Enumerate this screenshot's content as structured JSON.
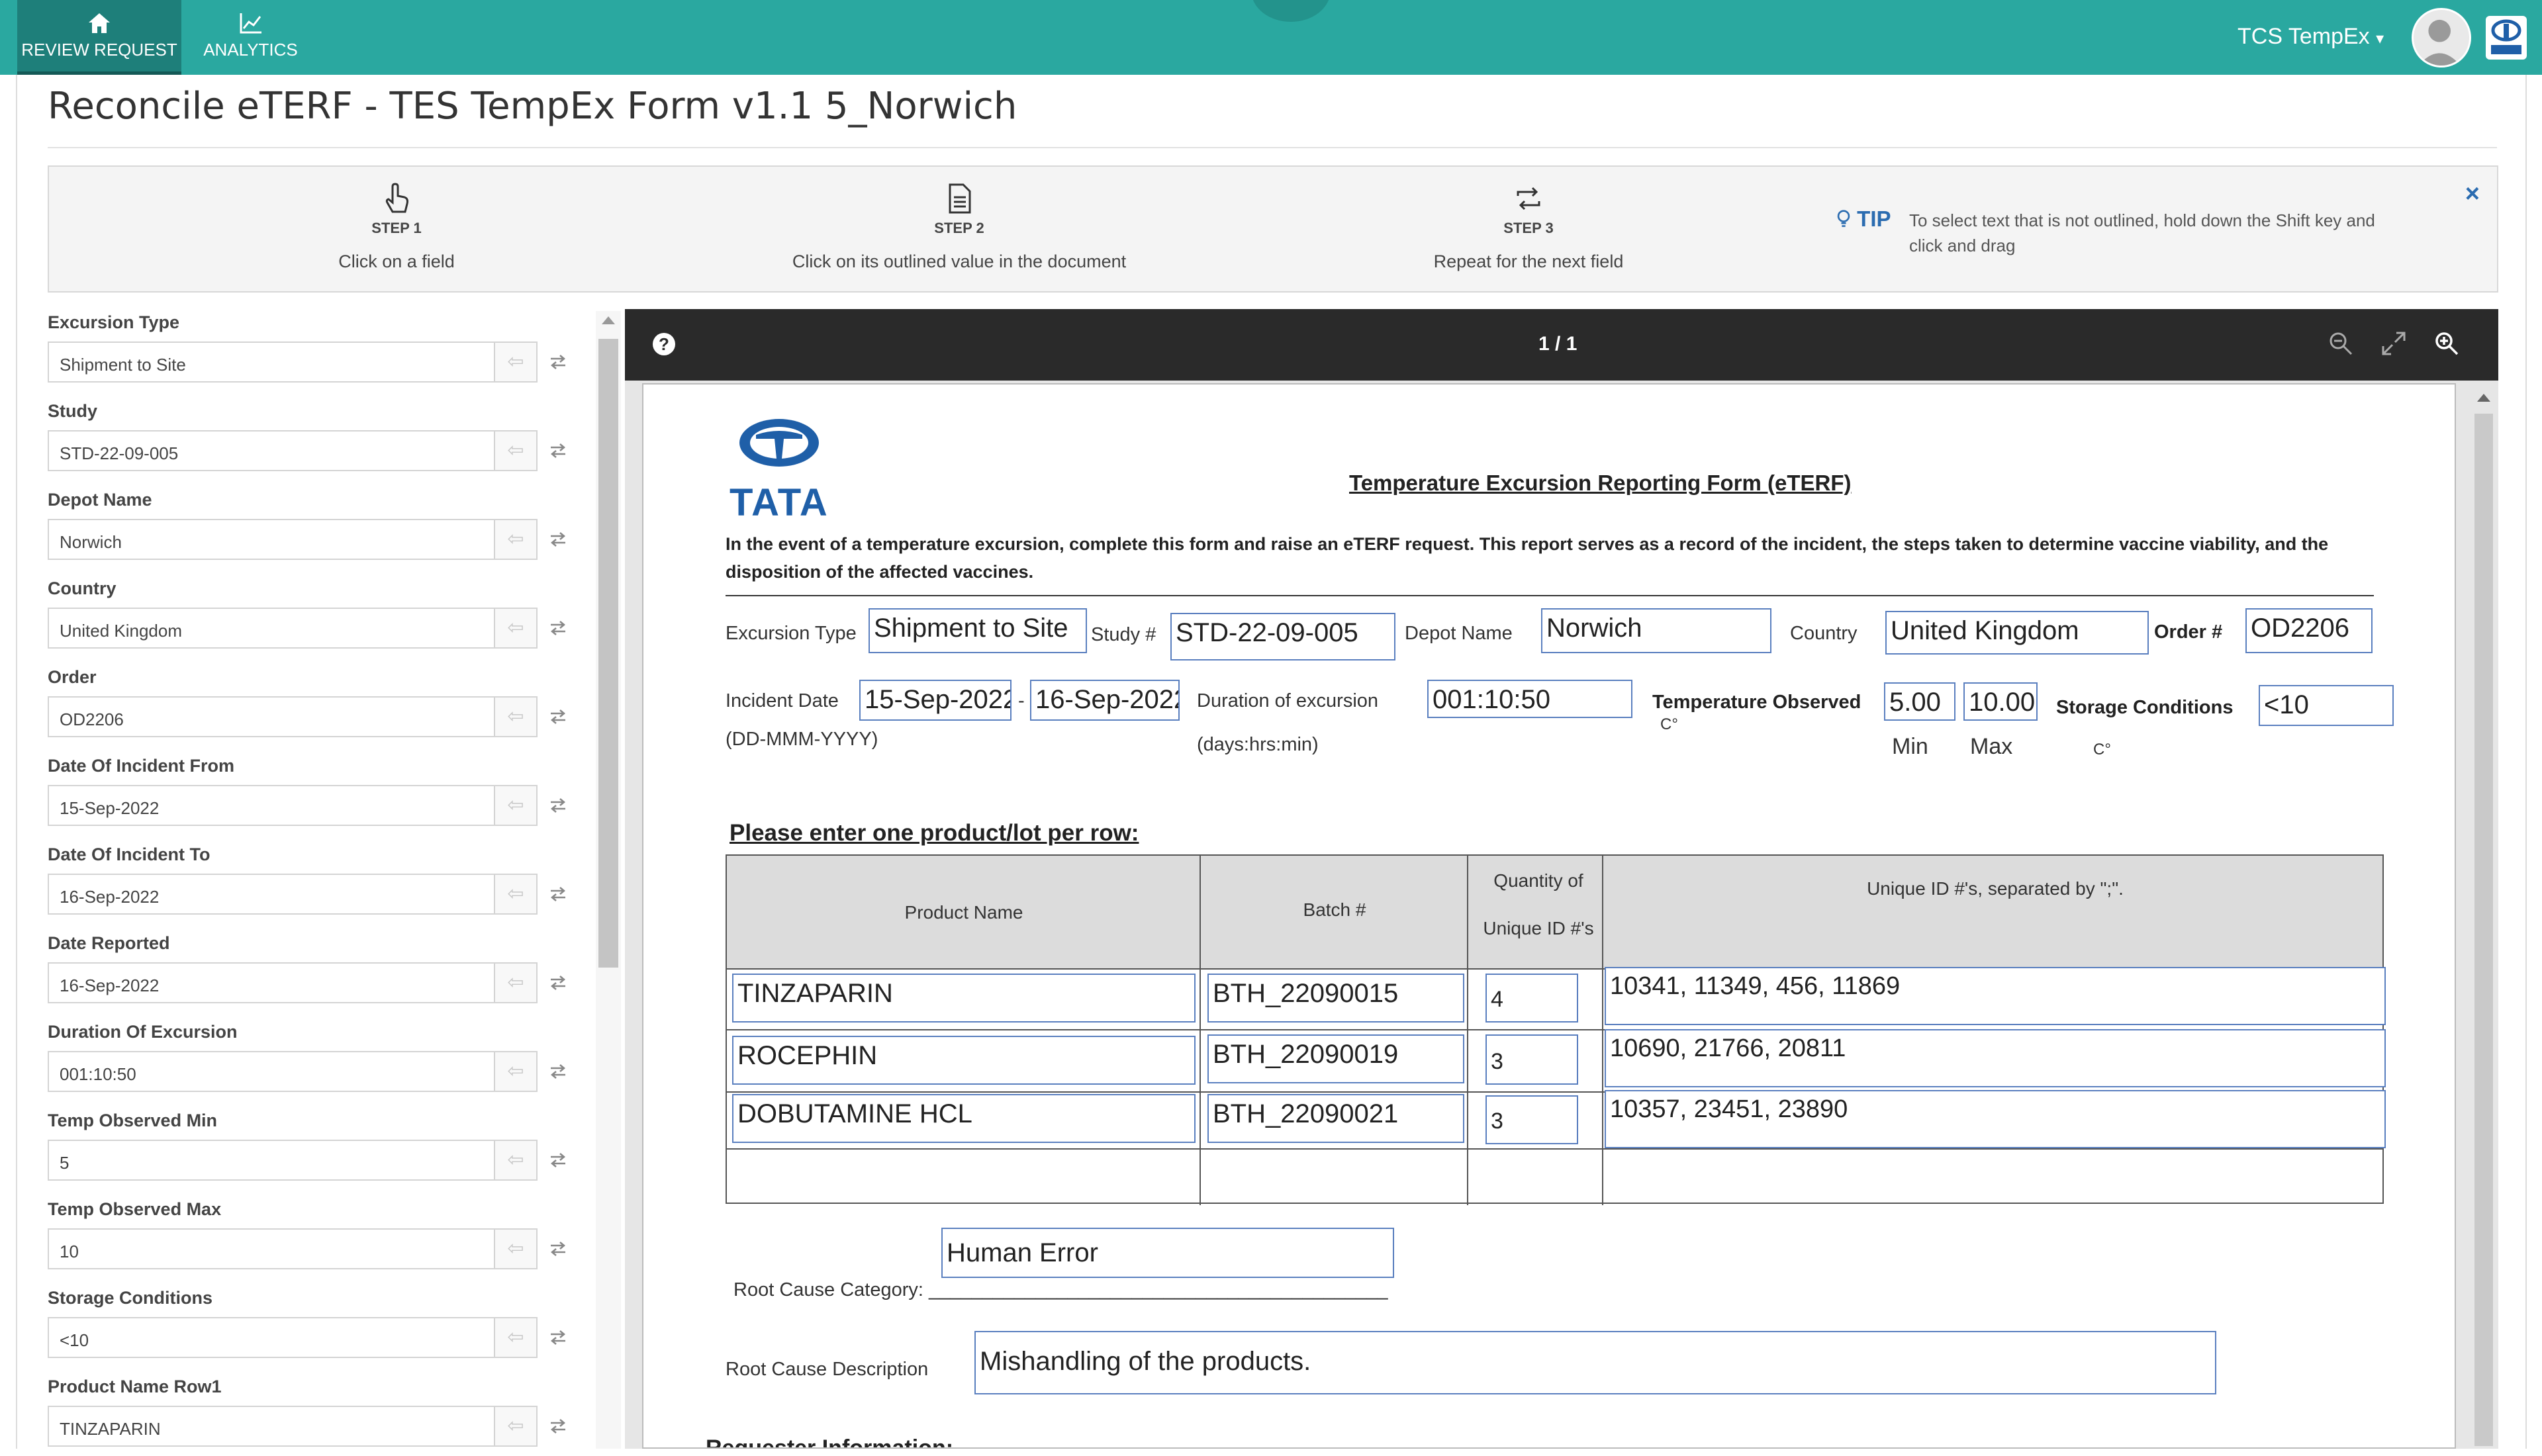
{
  "topbar": {
    "nav": [
      {
        "label": "REVIEW REQUEST",
        "icon": "home-icon",
        "active": true
      },
      {
        "label": "ANALYTICS",
        "icon": "chart-icon",
        "active": false
      }
    ],
    "user": "TCS TempEx",
    "user_caret": "▾"
  },
  "page": {
    "title": "Reconcile eTERF - TES TempEx Form v1.1 5_Norwich"
  },
  "steps": [
    {
      "num": "STEP 1",
      "text": "Click on a field",
      "icon": "pointer-hand-icon"
    },
    {
      "num": "STEP 2",
      "text": "Click on its outlined value in the document",
      "icon": "document-icon"
    },
    {
      "num": "STEP 3",
      "text": "Repeat for the next field",
      "icon": "repeat-icon"
    }
  ],
  "tip": {
    "label": "TIP",
    "text": "To select text that is not outlined, hold down the Shift key and click and drag",
    "close": "×"
  },
  "form": {
    "fields": [
      {
        "label": "Excursion Type",
        "value": "Shipment to Site"
      },
      {
        "label": "Study",
        "value": "STD-22-09-005"
      },
      {
        "label": "Depot Name",
        "value": "Norwich"
      },
      {
        "label": "Country",
        "value": "United Kingdom"
      },
      {
        "label": "Order",
        "value": "OD2206"
      },
      {
        "label": "Date Of Incident From",
        "value": "15-Sep-2022"
      },
      {
        "label": "Date Of Incident To",
        "value": "16-Sep-2022"
      },
      {
        "label": "Date Reported",
        "value": "16-Sep-2022"
      },
      {
        "label": "Duration Of Excursion",
        "value": "001:10:50"
      },
      {
        "label": "Temp Observed Min",
        "value": "5"
      },
      {
        "label": "Temp Observed Max",
        "value": "10"
      },
      {
        "label": "Storage Conditions",
        "value": "<10"
      },
      {
        "label": "Product Name Row1",
        "value": "TINZAPARIN"
      }
    ]
  },
  "viewer": {
    "help": "?",
    "page_count": "1 / 1"
  },
  "doc": {
    "logo_text": "TATA",
    "title": "Temperature Excursion Reporting Form (eTERF)",
    "intro": "In the event of a temperature excursion, complete this form and raise an eTERF request. This report serves as a record of the incident, the steps taken to determine vaccine viability, and the disposition of the affected vaccines.",
    "labels": {
      "excursion_type": "Excursion Type",
      "study": "Study #",
      "depot": "Depot Name",
      "country": "Country",
      "order": "Order #",
      "incident_date": "Incident Date",
      "date_format": "(DD-MMM-YYYY)",
      "date_sep": "-",
      "duration": "Duration of excursion",
      "duration_format": "(days:hrs:min)",
      "temp_observed": "Temperature Observed",
      "temp_unit": "C°",
      "min": "Min",
      "max": "Max",
      "storage": "Storage Conditions",
      "storage_unit": "C°",
      "table_heading": "Please enter one product/lot per row:",
      "root_cause_category": "Root Cause Category: ___________________________________________",
      "root_cause_description": "Root Cause Description",
      "requester": "Requester Information:"
    },
    "values": {
      "excursion_type": "Shipment to Site",
      "study": "STD-22-09-005",
      "depot": "Norwich",
      "country": "United Kingdom",
      "order": "OD2206",
      "date_from": "15-Sep-2022",
      "date_to": "16-Sep-2022",
      "duration": "001:10:50",
      "temp_min": "5.00",
      "temp_max": "10.00",
      "storage": "<10",
      "root_cause_category": "Human Error",
      "root_cause_description": "Mishandling of the products."
    },
    "table": {
      "headers": [
        "Product Name",
        "Batch #",
        "Quantity of Unique ID #'s",
        "Unique ID #'s, separated by \";\"."
      ],
      "rows": [
        {
          "product": "TINZAPARIN",
          "batch": "BTH_22090015",
          "qty": "4",
          "ids": "10341, 11349, 456, 11869"
        },
        {
          "product": "ROCEPHIN",
          "batch": "BTH_22090019",
          "qty": "3",
          "ids": "10690, 21766, 20811"
        },
        {
          "product": "DOBUTAMINE HCL",
          "batch": "BTH_22090021",
          "qty": "3",
          "ids": "10357, 23451, 23890"
        }
      ]
    }
  },
  "colors": {
    "topbar": "#2aa8a0",
    "active_nav": "#1e7f7a",
    "tip": "#2b6cb0",
    "outline": "#5a7fbf"
  }
}
